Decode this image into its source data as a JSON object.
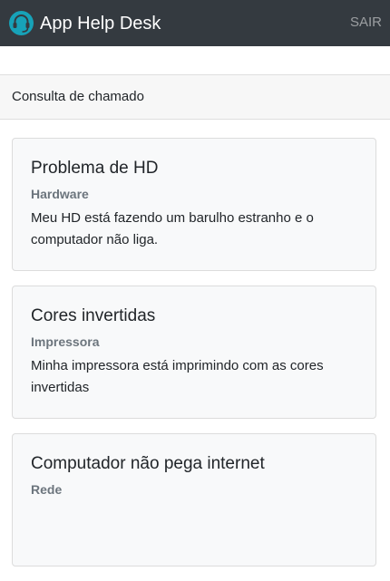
{
  "navbar": {
    "brand_icon": "headset-icon",
    "brand_title": "App Help Desk",
    "logout_label": "SAIR"
  },
  "page": {
    "header": "Consulta de chamado"
  },
  "tickets": [
    {
      "title": "Problema de HD",
      "category": "Hardware",
      "description": "Meu HD está fazendo um barulho estranho e o computador não liga."
    },
    {
      "title": "Cores invertidas",
      "category": "Impressora",
      "description": "Minha impressora está imprimindo com as cores invertidas"
    },
    {
      "title": "Computador não pega internet",
      "category": "Rede",
      "description": ""
    }
  ],
  "colors": {
    "navbar_bg": "#343a40",
    "brand_icon": "#17a2b8",
    "card_bg": "#f8f9fa",
    "muted_text": "#6c757d"
  }
}
